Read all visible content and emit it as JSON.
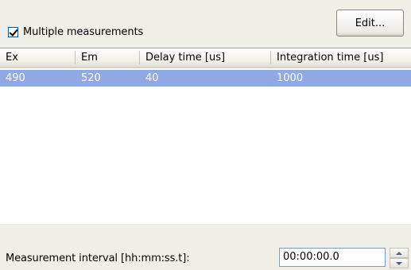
{
  "multiple": {
    "label": "Multiple measurements",
    "checked": true
  },
  "edit_button": {
    "label": "Edit..."
  },
  "table": {
    "columns": [
      "Ex",
      "Em",
      "Delay time [us]",
      "Integration time [us]"
    ],
    "rows": [
      [
        "490",
        "520",
        "40",
        "1000"
      ]
    ],
    "selected_row_color": "#8ea9e4"
  },
  "interval": {
    "label": "Measurement  interval [hh:mm:ss.t]:",
    "value": "00:00:00.0"
  },
  "icons": {
    "checkbox": "check-mark",
    "spin_up": "arrow-up-icon",
    "spin_down": "arrow-down-icon"
  }
}
